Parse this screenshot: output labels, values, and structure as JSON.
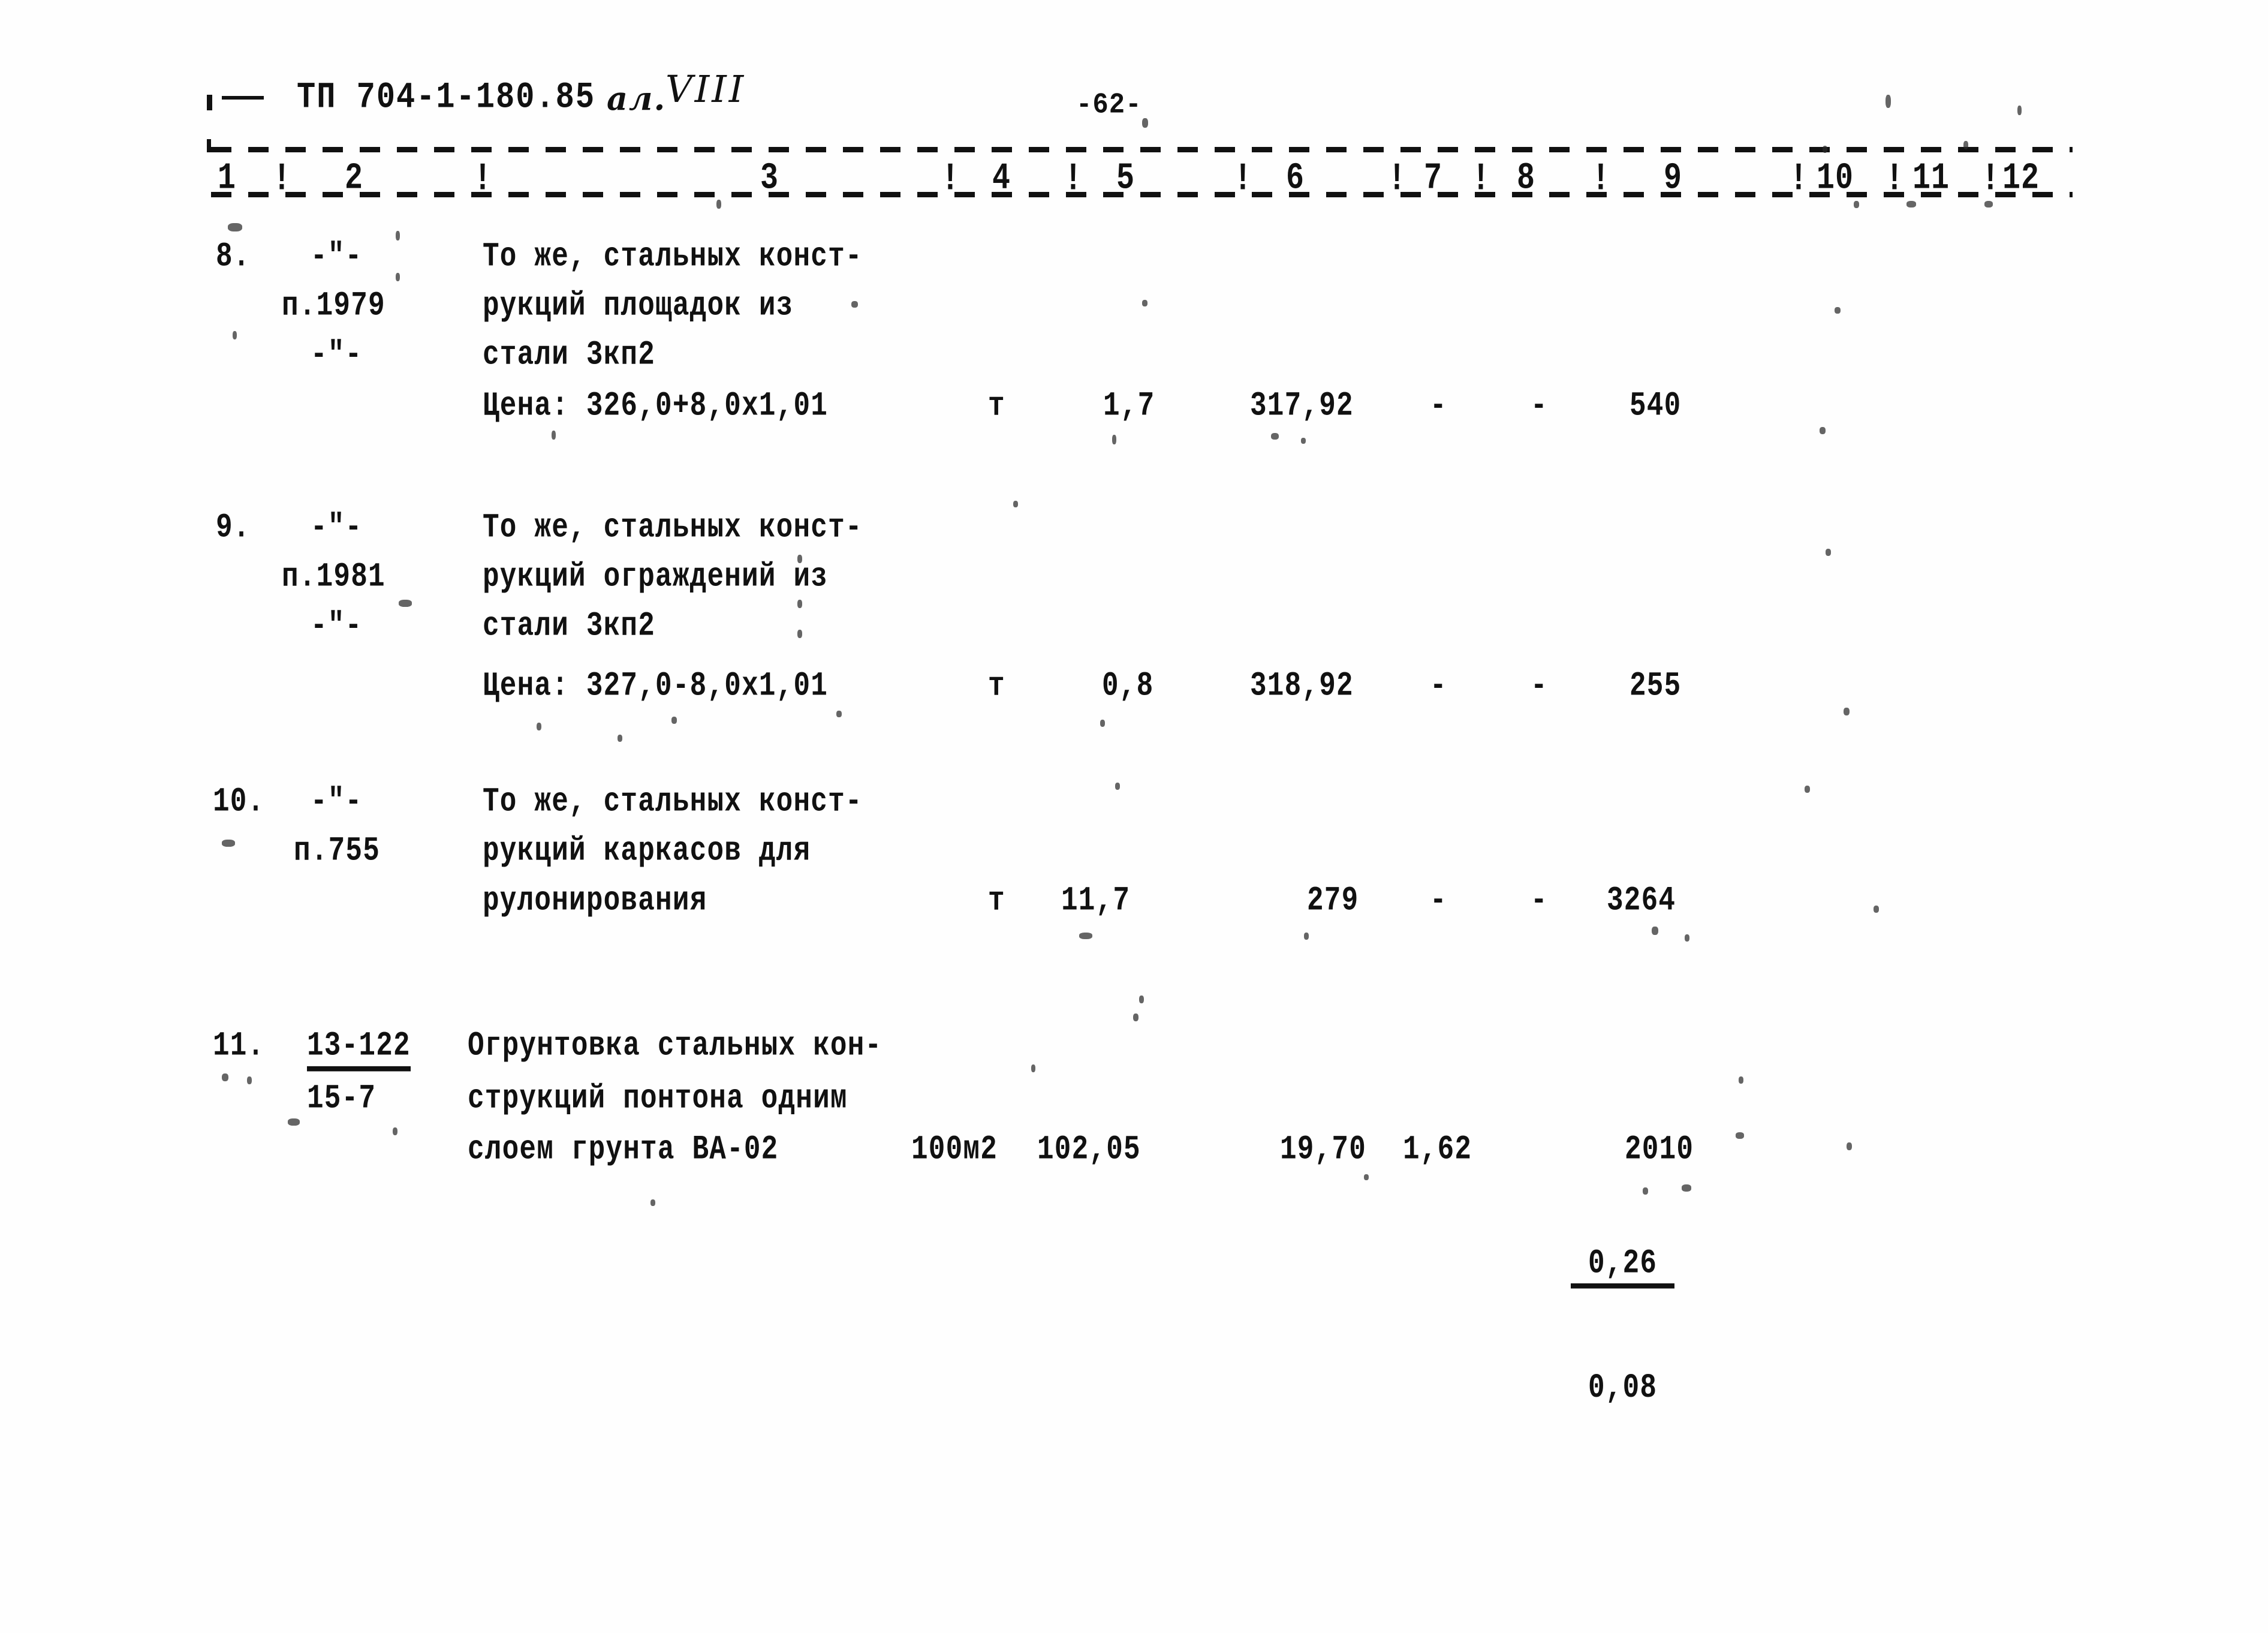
{
  "document": {
    "code": "ТП 704-1-180.85",
    "album_label": "ал.",
    "album_number": "VIII",
    "page_number": "-62-"
  },
  "table": {
    "column_headers": [
      "1",
      "2",
      "3",
      "4",
      "5",
      "6",
      "7",
      "8",
      "9",
      "10",
      "11",
      "12"
    ],
    "column_separator": "!",
    "rows": [
      {
        "num": "8.",
        "col2": [
          "-\"-",
          "п.1979",
          "-\"-"
        ],
        "description": [
          "То же, стальных конст-",
          "рукций площадок из",
          "стали 3кп2"
        ],
        "price_line": "Цена: 326,0+8,0х1,01",
        "unit": "т",
        "qty": "1,7",
        "c6": "317,92",
        "c7": "-",
        "c8": "-",
        "c9": "540",
        "c10": "",
        "c11": "",
        "c12": ""
      },
      {
        "num": "9.",
        "col2": [
          "-\"-",
          "п.1981",
          "-\"-"
        ],
        "description": [
          "То же, стальных конст-",
          "рукций ограждений из",
          "стали 3кп2"
        ],
        "price_line": "Цена: 327,0-8,0х1,01",
        "unit": "т",
        "qty": "0,8",
        "c6": "318,92",
        "c7": "-",
        "c8": "-",
        "c9": "255",
        "c10": "",
        "c11": "",
        "c12": ""
      },
      {
        "num": "10.",
        "col2": [
          "-\"-",
          "п.755",
          ""
        ],
        "description": [
          "То же, стальных конст-",
          "рукций каркасов для",
          "рулонирования"
        ],
        "price_line": "",
        "unit": "т",
        "qty": "11,7",
        "c6": "279",
        "c7": "-",
        "c8": "-",
        "c9": "3264",
        "c10": "",
        "c11": "",
        "c12": ""
      },
      {
        "num": "11.",
        "col2": [
          "13-122",
          "15-7",
          ""
        ],
        "description": [
          "Огрунтовка стальных кон-",
          "струкций понтона одним",
          "слоем грунта ВА-02"
        ],
        "price_line": "",
        "unit": "100м2",
        "qty": "102,05",
        "c6": "19,70",
        "c7": "1,62",
        "c8_top": "0,26",
        "c8_bot": "0,08",
        "c9": "2010",
        "c10": "",
        "c11": "",
        "c12": ""
      }
    ]
  }
}
